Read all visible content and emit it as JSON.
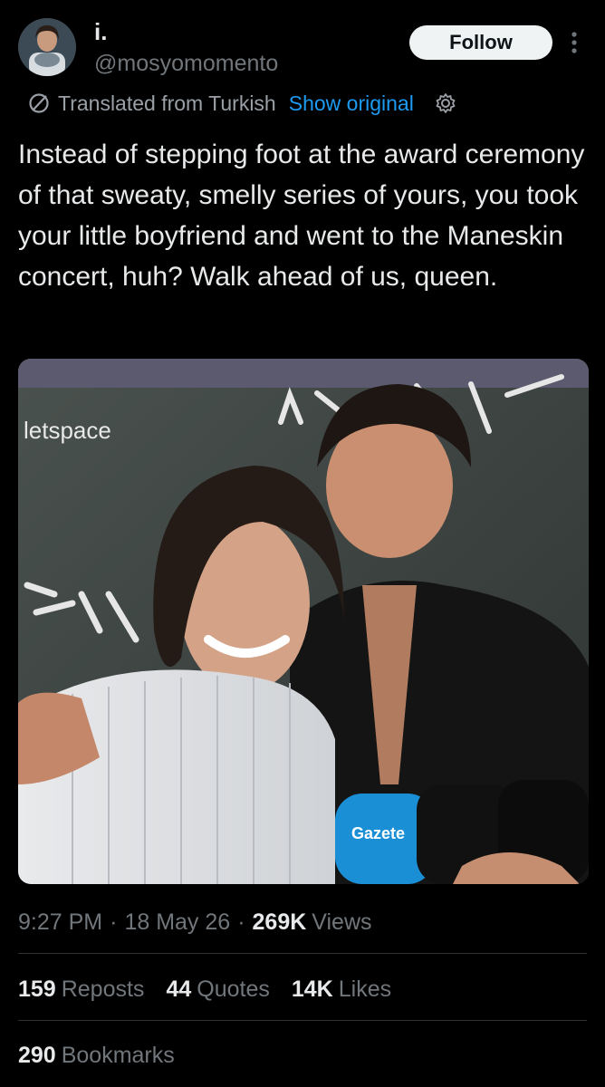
{
  "author": {
    "display_name": "i.",
    "handle": "@mosyomomento",
    "avatar_icon": "avatar-photo"
  },
  "follow_label": "Follow",
  "translation": {
    "label": "Translated from Turkish",
    "show_original": "Show original",
    "accent": "#1d9bf0"
  },
  "tweet_text": "Instead of stepping foot at the award ceremony of that sweaty, smelly series of yours, you took your little boyfriend and went to the Maneskin concert, huh? Walk ahead of us, queen.",
  "media": {
    "caption": "letspace"
  },
  "meta": {
    "time": "9:27 PM",
    "date": "18 May 26",
    "views_count": "269K",
    "views_label": "Views"
  },
  "stats": {
    "reposts_count": "159",
    "reposts_label": "Reposts",
    "quotes_count": "44",
    "quotes_label": "Quotes",
    "likes_count": "14K",
    "likes_label": "Likes",
    "bookmarks_count": "290",
    "bookmarks_label": "Bookmarks"
  },
  "colors": {
    "background": "#000000",
    "text_primary": "#e7e9ea",
    "text_secondary": "#71767b",
    "divider": "#2f3336"
  }
}
